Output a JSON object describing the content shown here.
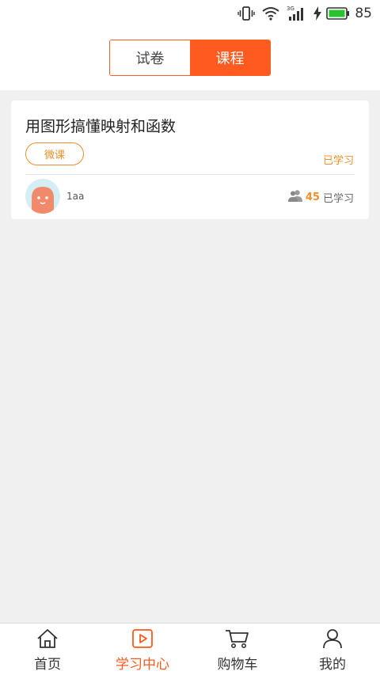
{
  "status_bar": {
    "network": "3G",
    "battery": "85",
    "icons": [
      "vibrate-icon",
      "wifi-icon",
      "signal-icon",
      "charging-icon",
      "battery-icon"
    ]
  },
  "segment": {
    "tabs": [
      {
        "label": "试卷",
        "active": false
      },
      {
        "label": "课程",
        "active": true
      }
    ]
  },
  "course": {
    "title": "用图形搞懂映射和函数",
    "tag": "微课",
    "status": "已学习",
    "author": "1aa",
    "learner_count": "45",
    "learner_suffix": "已学习"
  },
  "tabbar": {
    "items": [
      {
        "label": "首页",
        "icon": "home-icon"
      },
      {
        "label": "学习中心",
        "icon": "play-icon"
      },
      {
        "label": "购物车",
        "icon": "cart-icon"
      },
      {
        "label": "我的",
        "icon": "user-icon"
      }
    ]
  },
  "colors": {
    "accent": "#ff5a1f",
    "tag": "#f0902a",
    "background": "#f0f0f0"
  }
}
